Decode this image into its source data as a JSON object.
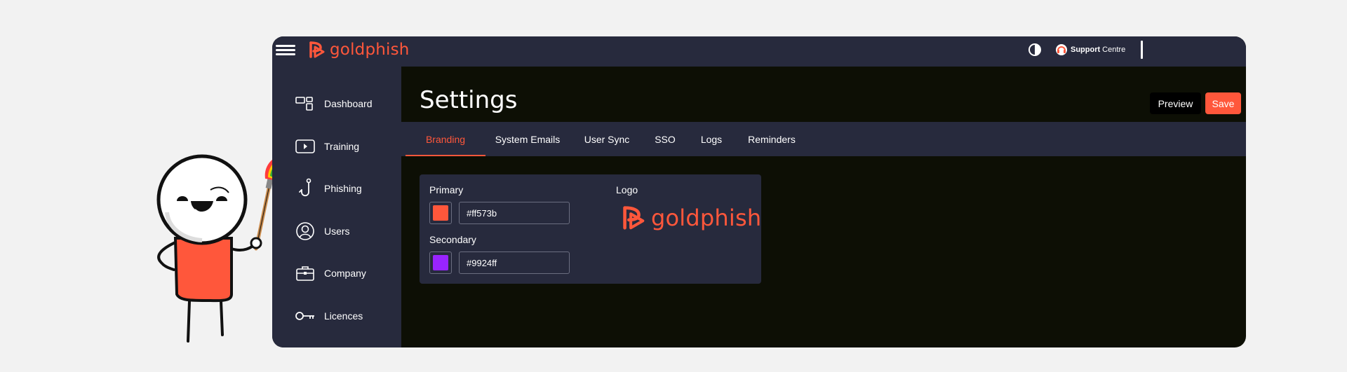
{
  "app": {
    "brand": "goldphish",
    "support": {
      "bold": "Support",
      "light": "Centre"
    }
  },
  "sidebar": {
    "items": [
      {
        "label": "Dashboard",
        "icon": "dashboard-icon"
      },
      {
        "label": "Training",
        "icon": "play-icon"
      },
      {
        "label": "Phishing",
        "icon": "hook-icon"
      },
      {
        "label": "Users",
        "icon": "user-icon"
      },
      {
        "label": "Company",
        "icon": "briefcase-icon"
      },
      {
        "label": "Licences",
        "icon": "key-icon"
      }
    ]
  },
  "header": {
    "title": "Settings",
    "preview_label": "Preview",
    "save_label": "Save"
  },
  "tabs": [
    {
      "label": "Branding",
      "active": true
    },
    {
      "label": "System Emails"
    },
    {
      "label": "User Sync"
    },
    {
      "label": "SSO"
    },
    {
      "label": "Logs"
    },
    {
      "label": "Reminders"
    }
  ],
  "branding": {
    "primary_label": "Primary",
    "primary_value": "#ff573b",
    "secondary_label": "Secondary",
    "secondary_value": "#9924ff",
    "logo_label": "Logo",
    "logo_text": "goldphish"
  },
  "colors": {
    "accent": "#ff573b",
    "panel": "#272a3d",
    "content_bg": "#0d0f05",
    "secondary": "#9924ff"
  }
}
